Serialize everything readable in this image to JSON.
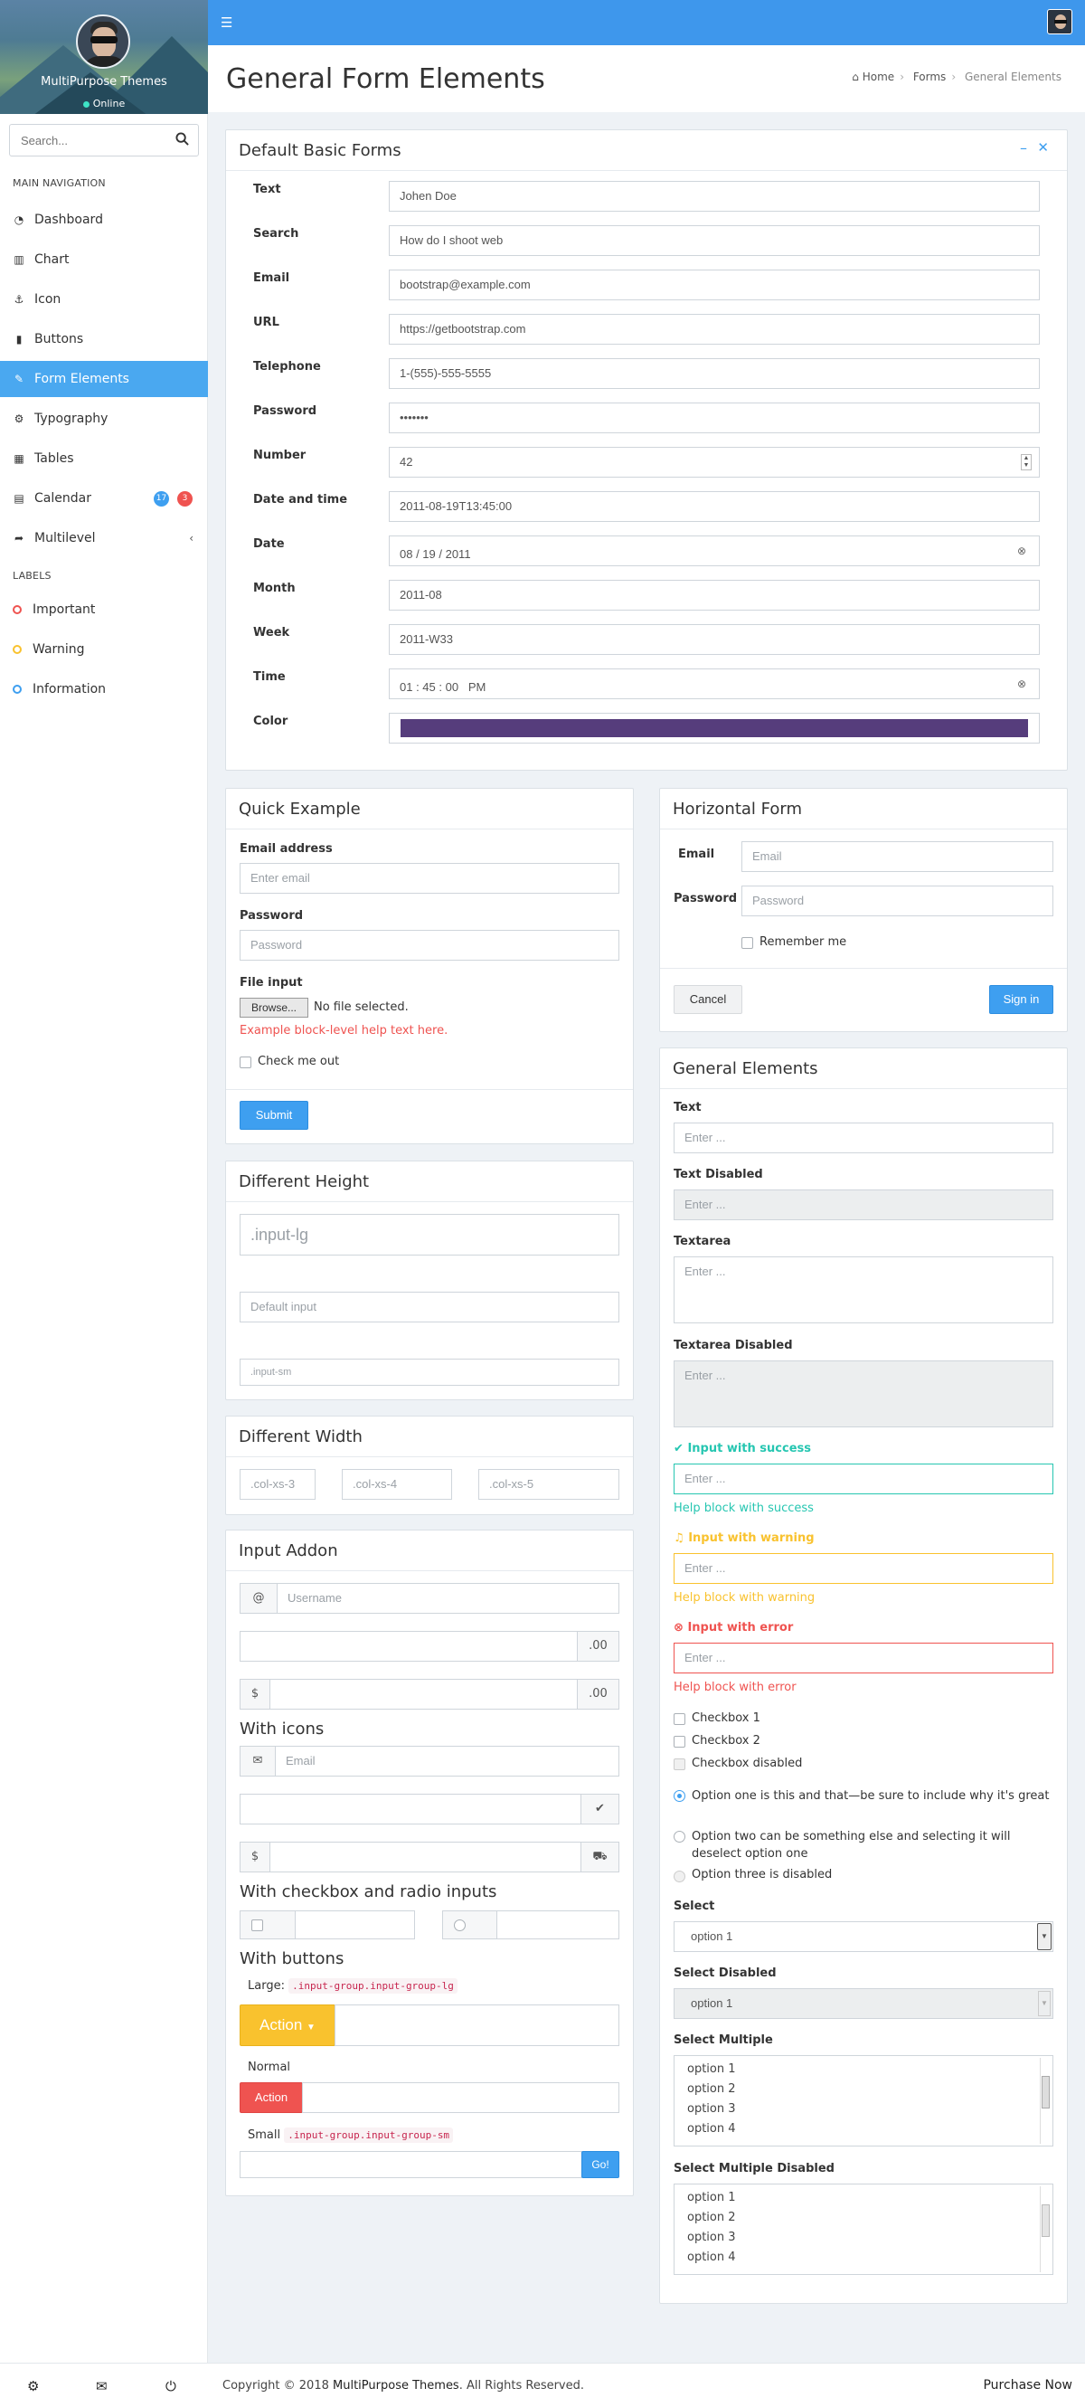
{
  "sidebar": {
    "user_name": "MultiPurpose Themes",
    "status": "Online",
    "search_placeholder": "Search...",
    "main_nav_header": "MAIN NAVIGATION",
    "items": [
      {
        "label": "Dashboard",
        "icon": "dashboard-icon"
      },
      {
        "label": "Chart",
        "icon": "bar-chart-icon"
      },
      {
        "label": "Icon",
        "icon": "anchor-icon"
      },
      {
        "label": "Buttons",
        "icon": "bookmark-icon"
      },
      {
        "label": "Form Elements",
        "icon": "edit-icon",
        "active": true
      },
      {
        "label": "Typography",
        "icon": "cogs-icon"
      },
      {
        "label": "Tables",
        "icon": "table-icon"
      },
      {
        "label": "Calendar",
        "icon": "calendar-icon",
        "badges": [
          "17",
          "3"
        ]
      },
      {
        "label": "Multilevel",
        "icon": "share-icon"
      }
    ],
    "labels_header": "LABELS",
    "labels": [
      {
        "label": "Important",
        "color": "#ef5350"
      },
      {
        "label": "Warning",
        "color": "#f9c22e"
      },
      {
        "label": "Information",
        "color": "#3e9ff0"
      }
    ]
  },
  "header": {
    "page_title": "General Form Elements",
    "breadcrumb": [
      "Home",
      "Forms",
      "General Elements"
    ]
  },
  "basic_forms": {
    "title": "Default Basic Forms",
    "rows": [
      {
        "label": "Text",
        "value": "Johen Doe"
      },
      {
        "label": "Search",
        "value": "How do I shoot web"
      },
      {
        "label": "Email",
        "value": "bootstrap@example.com"
      },
      {
        "label": "URL",
        "value": "https://getbootstrap.com"
      },
      {
        "label": "Telephone",
        "value": "1-(555)-555-5555"
      },
      {
        "label": "Password",
        "value": "•••••••"
      },
      {
        "label": "Number",
        "value": "42"
      },
      {
        "label": "Date and time",
        "value": "2011-08-19T13:45:00"
      },
      {
        "label": "Date",
        "value": "08 / 19 / 2011"
      },
      {
        "label": "Month",
        "value": "2011-08"
      },
      {
        "label": "Week",
        "value": "2011-W33"
      },
      {
        "label": "Time",
        "value": "01 : 45 : 00   PM"
      },
      {
        "label": "Color",
        "value": "#563d7c"
      }
    ]
  },
  "quick_example": {
    "title": "Quick Example",
    "email_label": "Email address",
    "email_placeholder": "Enter email",
    "password_label": "Password",
    "password_placeholder": "Password",
    "file_label": "File input",
    "browse": "Browse...",
    "no_file": "No file selected.",
    "help": "Example block-level help text here.",
    "check_label": "Check me out",
    "submit": "Submit"
  },
  "horizontal_form": {
    "title": "Horizontal Form",
    "email_label": "Email",
    "email_placeholder": "Email",
    "password_label": "Password",
    "password_placeholder": "Password",
    "remember": "Remember me",
    "cancel": "Cancel",
    "signin": "Sign in"
  },
  "different_height": {
    "title": "Different Height",
    "lg": ".input-lg",
    "default": "Default input",
    "sm": ".input-sm"
  },
  "different_width": {
    "title": "Different Width",
    "fields": [
      ".col-xs-3",
      ".col-xs-4",
      ".col-xs-5"
    ]
  },
  "input_addon": {
    "title": "Input Addon",
    "at": "@",
    "username_placeholder": "Username",
    "suffix": ".00",
    "dollar": "$",
    "with_icons": "With icons",
    "email_placeholder": "Email",
    "with_checkbox": "With checkbox and radio inputs",
    "with_buttons": "With buttons",
    "large_label": "Large:",
    "large_code": ".input-group.input-group-lg",
    "action_lg": "Action",
    "normal_label": "Normal",
    "action": "Action",
    "small_label": "Small",
    "small_code": ".input-group.input-group-sm",
    "go": "Go!"
  },
  "general_elements": {
    "title": "General Elements",
    "text_label": "Text",
    "text_disabled_label": "Text Disabled",
    "textarea_label": "Textarea",
    "textarea_disabled_label": "Textarea Disabled",
    "placeholder": "Enter ...",
    "success_label": "Input with success",
    "success_help": "Help block with success",
    "warning_label": "Input with warning",
    "warning_help": "Help block with warning",
    "error_label": "Input with error",
    "error_help": "Help block with error",
    "checkboxes": [
      "Checkbox 1",
      "Checkbox 2",
      "Checkbox disabled"
    ],
    "radio_1": "Option one is this and that—be sure to include why it's great",
    "radio_2": "Option two can be something else and selecting it will deselect option one",
    "radio_3": "Option three is disabled",
    "select_label": "Select",
    "select_value": "option 1",
    "select_disabled_label": "Select Disabled",
    "select_disabled_value": "option 1",
    "select_multiple_label": "Select Multiple",
    "options": [
      "option 1",
      "option 2",
      "option 3",
      "option 4"
    ],
    "select_multiple_disabled_label": "Select Multiple Disabled",
    "success_color": "#26c6b1",
    "warning_color": "#f9c22e",
    "error_color": "#ef5350"
  },
  "footer": {
    "copyright_pre": "Copyright © 2018 ",
    "brand": "MultiPurpose Themes",
    "copyright_post": ". All Rights Reserved.",
    "purchase": "Purchase Now"
  }
}
